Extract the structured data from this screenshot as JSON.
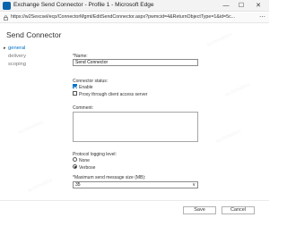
{
  "window": {
    "title": "Exchange Send Connector - Profile 1 - Microsoft Edge",
    "minimize_glyph": "—",
    "maximize_glyph": "☐",
    "close_glyph": "✕",
    "app_icon": "edge-icon"
  },
  "browser": {
    "url": "https://w2Sexcsel/ecp/ConnectorMgmt/EditSendConnector.aspx?pwmcid=4&ReturnObjectType=1&id=5c...",
    "more_glyph": "⋯"
  },
  "page": {
    "heading": "Send Connector"
  },
  "nav": {
    "items": [
      {
        "label": "general",
        "active": true
      },
      {
        "label": "delivery",
        "active": false
      },
      {
        "label": "scoping",
        "active": false
      }
    ]
  },
  "form": {
    "name_label": "*Name:",
    "name_value": "Send Connector",
    "status_label": "Connector status:",
    "enable_label": "Enable",
    "enable_checked": true,
    "proxy_label": "Proxy through client access server",
    "proxy_checked": false,
    "comment_label": "Comment:",
    "comment_value": "",
    "logging_label": "Protocol logging level:",
    "logging_options": [
      {
        "label": "None",
        "selected": false
      },
      {
        "label": "Verbose",
        "selected": true
      }
    ],
    "max_size_label": "*Maximum send message size (MB):",
    "max_size_value": "35",
    "max_size_chevron": "∨"
  },
  "buttons": {
    "save": "Save",
    "cancel": "Cancel"
  },
  "watermark_text": "techmatteu"
}
